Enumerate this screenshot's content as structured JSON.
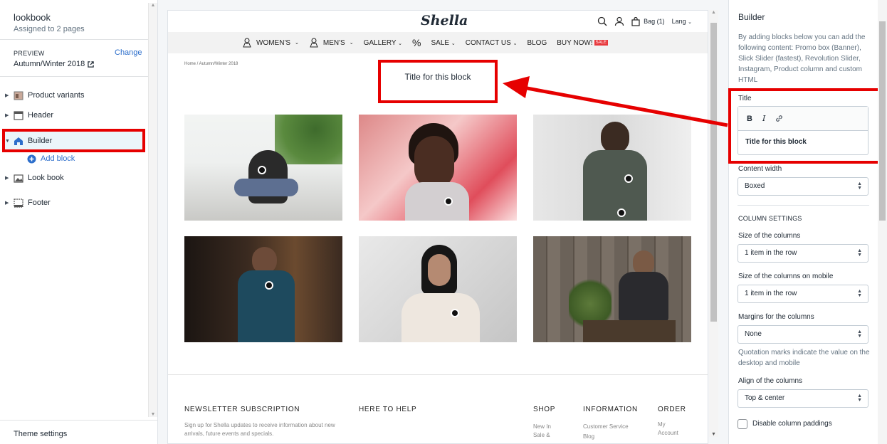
{
  "page": {
    "title": "lookbook",
    "subtitle": "Assigned to 2 pages"
  },
  "preview": {
    "label": "PREVIEW",
    "value": "Autumn/Winter 2018",
    "change": "Change"
  },
  "sections": [
    {
      "label": "Product variants"
    },
    {
      "label": "Header"
    },
    {
      "label": "Builder"
    },
    {
      "label": "Add block"
    },
    {
      "label": "Look book"
    },
    {
      "label": "Footer"
    }
  ],
  "theme_settings": "Theme settings",
  "store": {
    "logo": "Shella",
    "bag": "Bag (1)",
    "lang": "Lang",
    "nav": [
      "WOMEN'S",
      "MEN'S",
      "GALLERY",
      "%",
      "SALE",
      "CONTACT US",
      "BLOG",
      "BUY NOW!"
    ],
    "sale_badge": "SALE",
    "breadcrumb": "Home  /  Autumn/Winter 2018",
    "block_title": "Title for this block",
    "footer": {
      "newsletter_title": "NEWSLETTER SUBSCRIPTION",
      "newsletter_text": "Sign up for Shella updates to receive information about new arrivals, future events and specials.",
      "help_title": "HERE TO HELP",
      "shop_title": "SHOP",
      "shop_links": [
        "New In",
        "Sale &"
      ],
      "info_title": "INFORMATION",
      "info_links": [
        "Customer Service",
        "Blog"
      ],
      "order_title": "ORDER",
      "order_links": [
        "My",
        "Account"
      ]
    }
  },
  "panel": {
    "heading": "Builder",
    "description": "By adding blocks below you can add the following content: Promo box (Banner), Slick Slider (fastest), Revolution Slider, Instagram, Product column and custom HTML",
    "title_label": "Title",
    "title_value": "Title for this block",
    "content_width_label": "Content width",
    "content_width_value": "Boxed",
    "column_settings": "COLUMN SETTINGS",
    "size_columns_label": "Size of the columns",
    "size_columns_value": "1 item in the row",
    "size_mobile_label": "Size of the columns on mobile",
    "size_mobile_value": "1 item in the row",
    "margins_label": "Margins for the columns",
    "margins_value": "None",
    "quotation_note": "Quotation marks indicate the value on the desktop and mobile",
    "align_label": "Align of the columns",
    "align_value": "Top & center",
    "disable_paddings": "Disable column paddings"
  },
  "colors": {
    "highlight": "#e60000",
    "link": "#2c6ecb",
    "selected_bg": "#ebf5fa"
  }
}
